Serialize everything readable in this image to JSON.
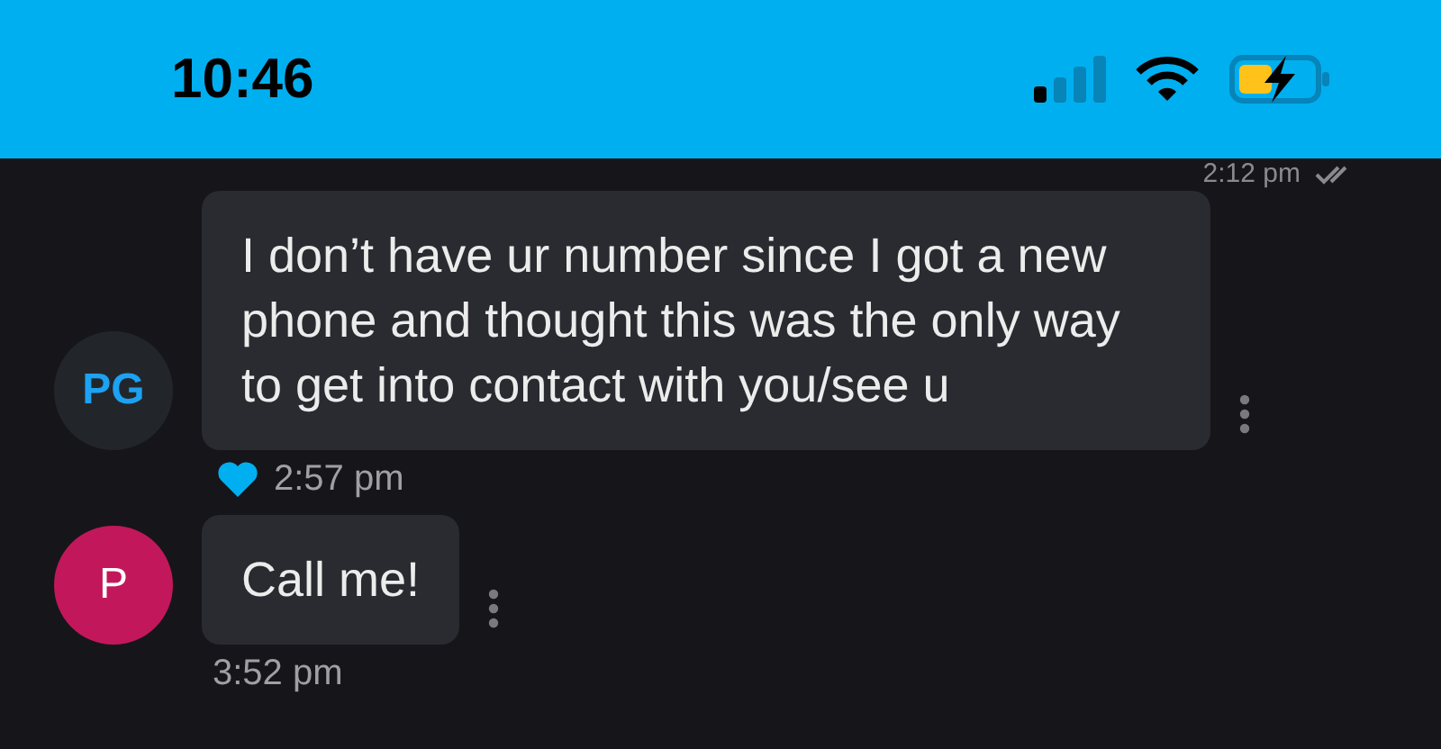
{
  "status_bar": {
    "time": "10:46"
  },
  "previous_message": {
    "time": "2:12 pm",
    "read": true
  },
  "messages": [
    {
      "avatar": "PG",
      "color": "#22262b",
      "text": "I don’t have ur number since I got a new phone and thought this was the only way to get into contact with you/see u",
      "liked": true,
      "time": "2:57 pm"
    },
    {
      "avatar": "P",
      "color": "#c2185b",
      "text": "Call me!",
      "liked": false,
      "time": "3:52 pm"
    }
  ]
}
